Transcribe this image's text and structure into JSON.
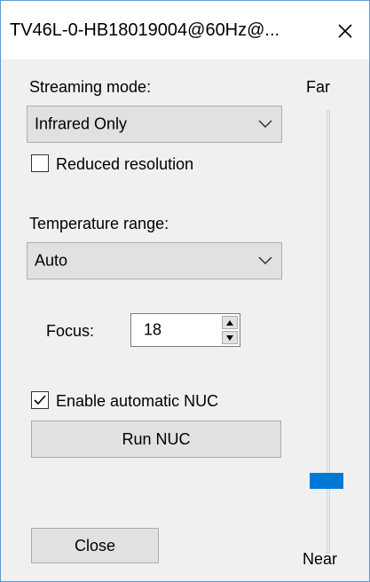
{
  "window": {
    "title": "TV46L-0-HB18019004@60Hz@...",
    "close_icon": "close-icon"
  },
  "streaming": {
    "label": "Streaming mode:",
    "selected": "Infrared Only"
  },
  "reduced_resolution": {
    "label": "Reduced resolution",
    "checked": false
  },
  "temperature": {
    "label": "Temperature range:",
    "selected": "Auto"
  },
  "focus": {
    "label": "Focus:",
    "value": "18"
  },
  "auto_nuc": {
    "label": "Enable automatic NUC",
    "checked": true
  },
  "run_nuc": {
    "label": "Run NUC"
  },
  "close_button": {
    "label": "Close"
  },
  "focus_slider": {
    "top_label": "Far",
    "bottom_label": "Near",
    "accent": "#0078d7"
  }
}
